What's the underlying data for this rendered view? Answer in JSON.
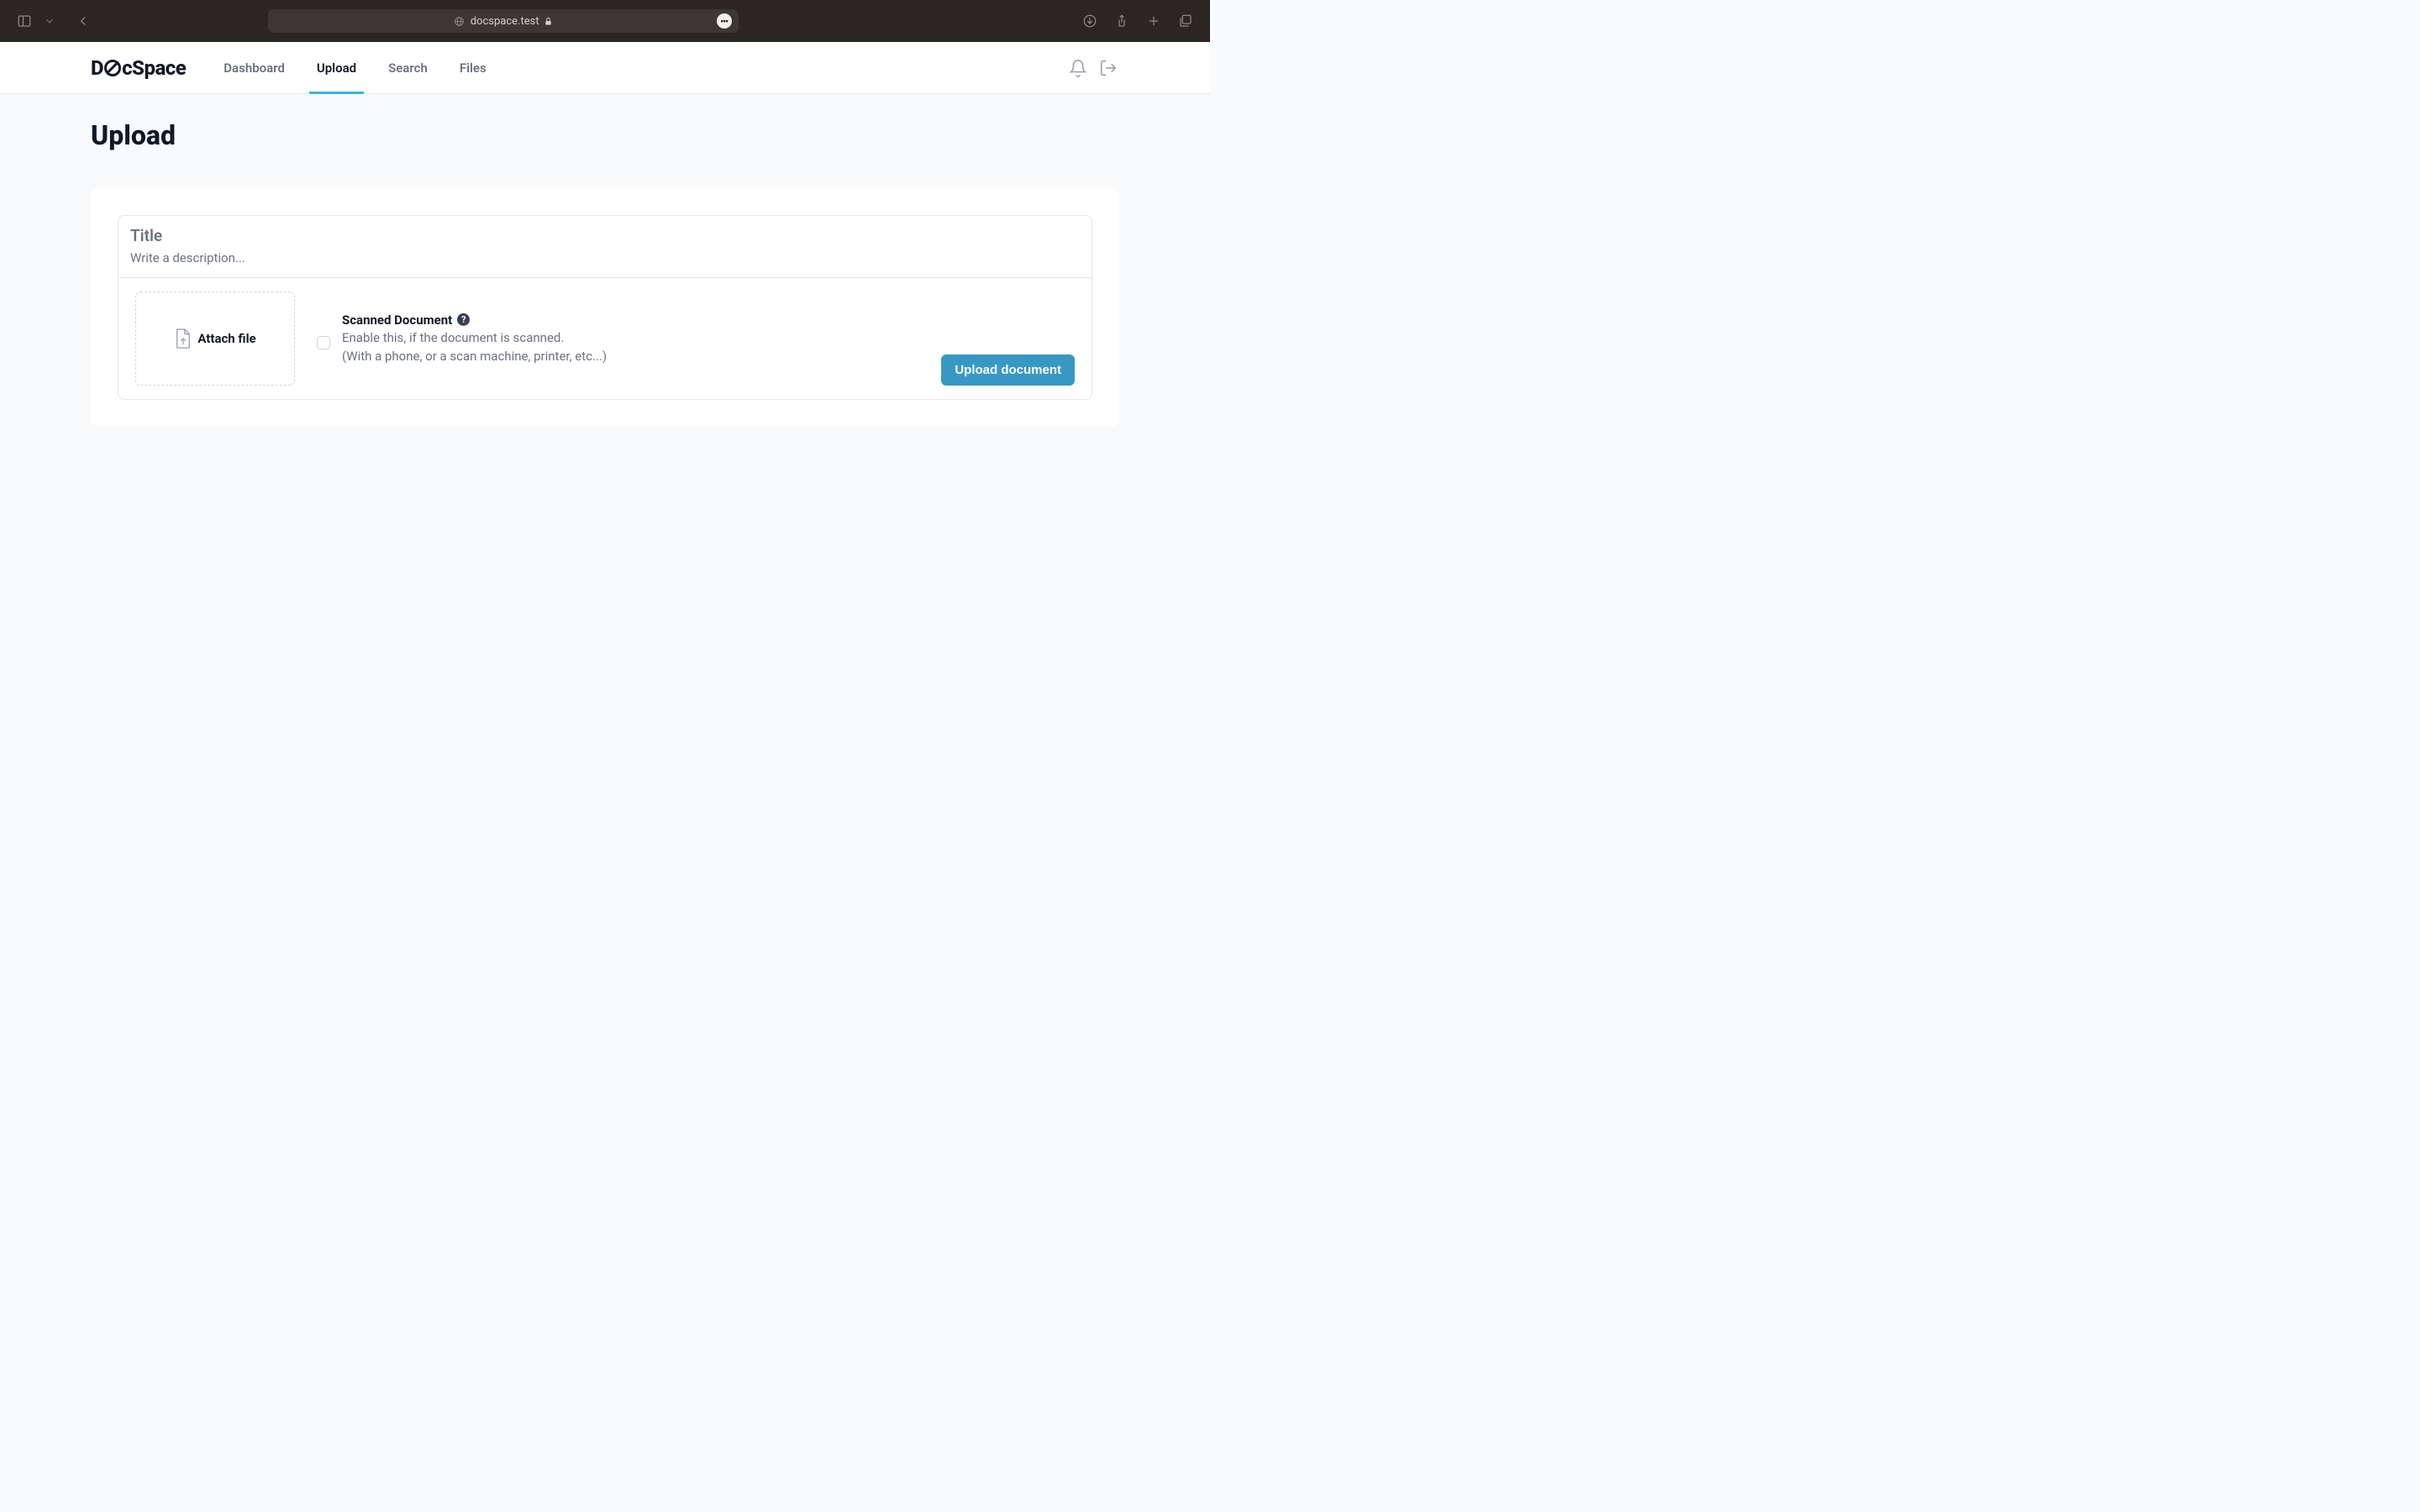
{
  "browser": {
    "url": "docspace.test"
  },
  "brand": {
    "name_left": "D",
    "name_right": "cSpace"
  },
  "nav": {
    "items": [
      {
        "label": "Dashboard",
        "active": false
      },
      {
        "label": "Upload",
        "active": true
      },
      {
        "label": "Search",
        "active": false
      },
      {
        "label": "Files",
        "active": false
      }
    ]
  },
  "page": {
    "title": "Upload"
  },
  "form": {
    "title_placeholder": "Title",
    "title_value": "",
    "description_placeholder": "Write a description...",
    "description_value": "",
    "dropzone_label": "Attach file",
    "scanned": {
      "title": "Scanned Document",
      "help_symbol": "?",
      "desc_line1": "Enable this, if the document is scanned.",
      "desc_line2": "(With a phone, or a scan machine, printer, etc...)",
      "checked": false
    },
    "submit_label": "Upload document"
  },
  "colors": {
    "accent": "#3898c5",
    "tab_underline": "#39b3e0",
    "text": "#111827",
    "muted": "#6b7280",
    "border": "#e5e7eb",
    "page_bg": "#f9fafb",
    "chrome_bg": "#2c2523"
  }
}
